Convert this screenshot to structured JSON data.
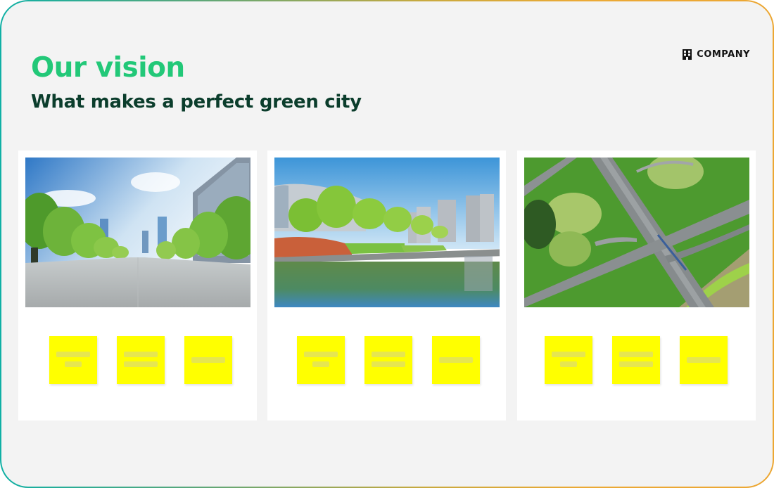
{
  "header": {
    "title": "Our vision",
    "subtitle_prefix": "What makes a perfect ",
    "subtitle_highlight": "green city",
    "brand_icon": "building-icon",
    "brand_label": "COMPANY"
  },
  "colors": {
    "title": "#22c878",
    "subtitle": "#0b3d2c",
    "highlight": "#12cc6a",
    "sticky_note": "#ffff00",
    "border_gradient_start": "#10b0a5",
    "border_gradient_end": "#eca733"
  },
  "cards": [
    {
      "image": "tree-lined-plaza-photo",
      "sticky_notes": [
        {
          "placeholder_lines": 2,
          "style": "long-short"
        },
        {
          "placeholder_lines": 2,
          "style": "long-long"
        },
        {
          "placeholder_lines": 1,
          "style": "long"
        }
      ]
    },
    {
      "image": "riverside-park-photo",
      "sticky_notes": [
        {
          "placeholder_lines": 2,
          "style": "long-short"
        },
        {
          "placeholder_lines": 2,
          "style": "long-long"
        },
        {
          "placeholder_lines": 1,
          "style": "long"
        }
      ]
    },
    {
      "image": "aerial-highway-park-photo",
      "sticky_notes": [
        {
          "placeholder_lines": 2,
          "style": "long-short"
        },
        {
          "placeholder_lines": 2,
          "style": "long-long"
        },
        {
          "placeholder_lines": 1,
          "style": "long"
        }
      ]
    }
  ]
}
